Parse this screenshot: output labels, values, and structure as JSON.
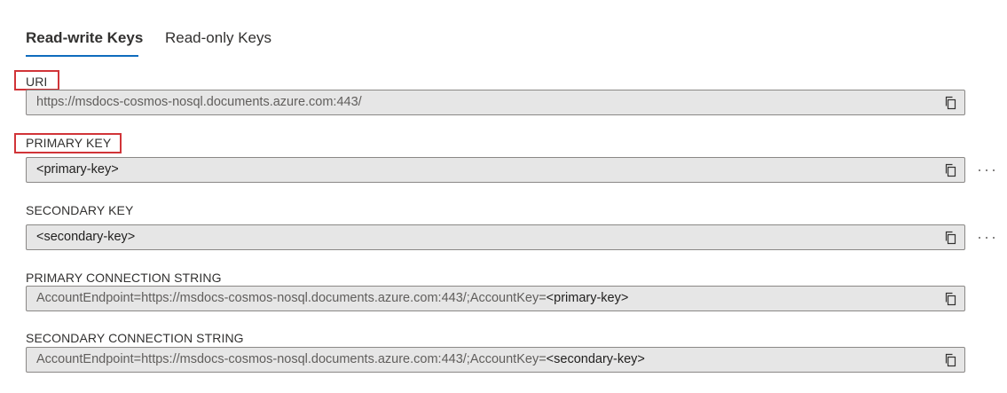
{
  "tabs": {
    "read_write": "Read-write Keys",
    "read_only": "Read-only Keys"
  },
  "fields": {
    "uri": {
      "label": "URI",
      "value": "https://msdocs-cosmos-nosql.documents.azure.com:443/"
    },
    "primary_key": {
      "label": "PRIMARY KEY",
      "value": "<primary-key>"
    },
    "secondary_key": {
      "label": "SECONDARY KEY",
      "value": "<secondary-key>"
    },
    "primary_connection_string": {
      "label": "PRIMARY CONNECTION STRING",
      "prefix": "AccountEndpoint=https://msdocs-cosmos-nosql.documents.azure.com:443/;AccountKey=",
      "key": "<primary-key>"
    },
    "secondary_connection_string": {
      "label": "SECONDARY CONNECTION STRING",
      "prefix": "AccountEndpoint=https://msdocs-cosmos-nosql.documents.azure.com:443/;AccountKey=",
      "key": "<secondary-key>"
    }
  },
  "icons": {
    "copy": "copy-icon",
    "more": "more-icon"
  },
  "colors": {
    "tab_underline": "#0f6cbd",
    "highlight_box": "#d13438",
    "field_background": "#e6e6e6"
  }
}
